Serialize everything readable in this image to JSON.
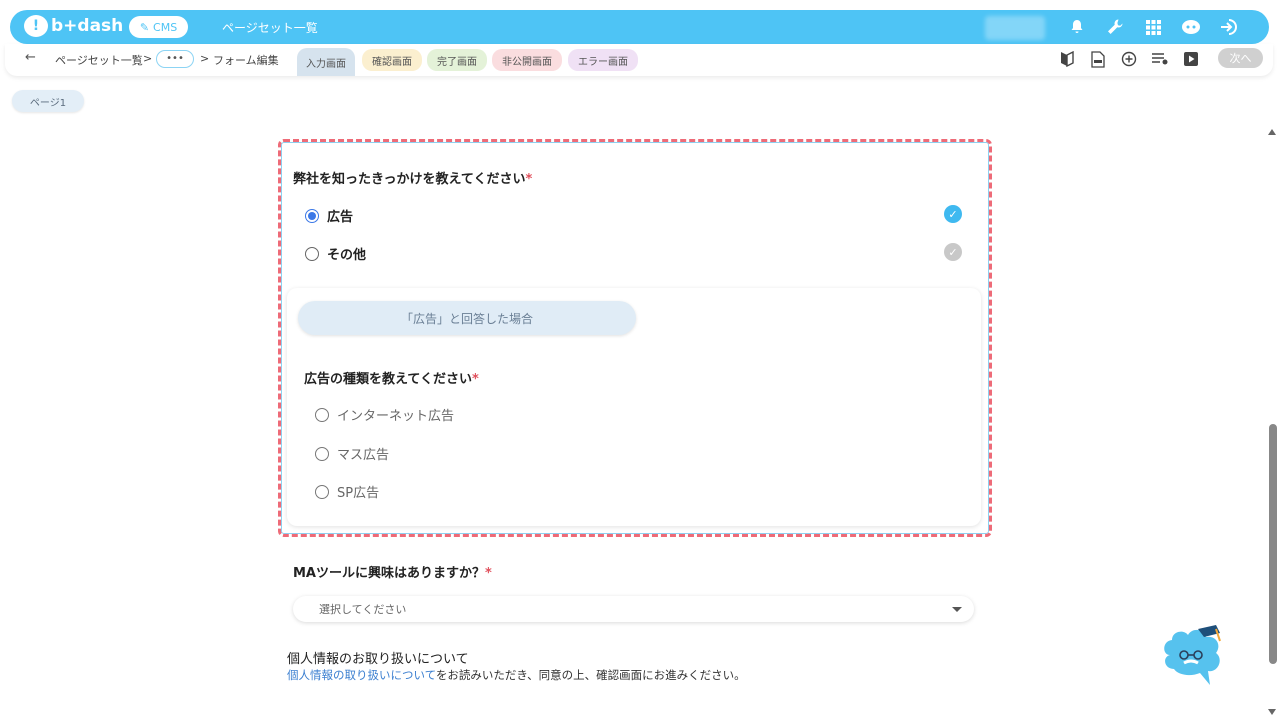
{
  "header": {
    "logo_text": "b+dash",
    "cms_label": "CMS",
    "title": "ページセット一覧"
  },
  "subbar": {
    "breadcrumb_root": "ページセット一覧",
    "breadcrumb_sep": ">",
    "ellipsis": "•••",
    "breadcrumb_current": "フォーム編集",
    "tabs": [
      {
        "label": "入力画面",
        "bg": "#d6e3ee"
      },
      {
        "label": "確認画面",
        "bg": "#fbefcf"
      },
      {
        "label": "完了画面",
        "bg": "#e4f2d8"
      },
      {
        "label": "非公開画面",
        "bg": "#fadddf"
      },
      {
        "label": "エラー画面",
        "bg": "#f0e1f5"
      }
    ],
    "next_label": "次へ"
  },
  "page_pill": "ページ1",
  "question1": {
    "label": "弊社を知ったきっかけを教えてください",
    "required": "*",
    "options": [
      {
        "label": "広告",
        "selected": true,
        "check_color": "#3fb9f0"
      },
      {
        "label": "その他",
        "selected": false,
        "check_color": "#c8c8c8"
      }
    ]
  },
  "condition": {
    "label": "「広告」と回答した場合",
    "question": "広告の種類を教えてください",
    "required": "*",
    "options": [
      "インターネット広告",
      "マス広告",
      "SP広告"
    ]
  },
  "question2": {
    "label": "MAツールに興味はありますか？",
    "required": "*",
    "placeholder": "選択してください"
  },
  "privacy": {
    "title": "個人情報のお取り扱いについて",
    "link_text": "個人情報の取り扱いについて",
    "text": "をお読みいただき、同意の上、確認画面にお進みください。"
  }
}
